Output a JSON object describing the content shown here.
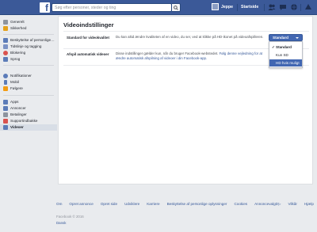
{
  "topbar": {
    "search_placeholder": "Søg efter personer, steder og ting",
    "user_name": "Jeppe",
    "home_label": "Startside",
    "brand_color": "#3b5998"
  },
  "sidebar": {
    "items": [
      {
        "label": "Generelt",
        "icon": "gear-icon",
        "color": "#8d949e"
      },
      {
        "label": "Sikkerhed",
        "icon": "shield-icon",
        "color": "#e4a11b"
      },
      {
        "label": "Beskyttelse af personlige…",
        "icon": "lock-icon",
        "color": "#5b7bb8"
      },
      {
        "label": "Tidslinje og tagging",
        "icon": "timeline-icon",
        "color": "#7b92c4"
      },
      {
        "label": "Blokering",
        "icon": "block-icon",
        "color": "#d9534f"
      },
      {
        "label": "Sprog",
        "icon": "language-icon",
        "color": "#5b7bb8"
      },
      {
        "label": "Notifikationer",
        "icon": "globe-icon",
        "color": "#5b7bb8"
      },
      {
        "label": "Mobil",
        "icon": "mobile-icon",
        "color": "#5b7bb8"
      },
      {
        "label": "Følgere",
        "icon": "rss-icon",
        "color": "#f39c12"
      },
      {
        "label": "Apps",
        "icon": "apps-icon",
        "color": "#5b7bb8"
      },
      {
        "label": "Annoncer",
        "icon": "ads-icon",
        "color": "#5b7bb8"
      },
      {
        "label": "Betalinger",
        "icon": "payment-icon",
        "color": "#8d949e"
      },
      {
        "label": "Supportindbakke",
        "icon": "support-icon",
        "color": "#d9534f"
      },
      {
        "label": "Videoer",
        "icon": "video-icon",
        "color": "#5b7bb8"
      }
    ]
  },
  "main": {
    "title": "Videoindstillinger",
    "rows": [
      {
        "label": "Standard for videokvalitet",
        "description": "Du kan altid ændre kvaliteten af en video, du ser, ved at klikke på HD-ikonet på videoafspilleren."
      },
      {
        "label": "Afspil automatisk videoer",
        "description_before": "Disse indstillinger gælder kun, når du bruger Facebook-webstedet. ",
        "description_link": "Følg denne vejledning for at ændre automatisk afspilning af videoer i din Facebook-app.",
        "description_after": ""
      }
    ],
    "dropdown": {
      "selected": "Standard",
      "options": [
        "Standard",
        "Kun SD",
        "HD hvis muligt"
      ],
      "highlighted": "HD hvis muligt",
      "button_color": "#4267b2"
    }
  },
  "footer": {
    "links": [
      "Om",
      "Opret annonce",
      "Opret side",
      "Udviklere",
      "Karriere",
      "Beskyttelse af personlige oplysninger",
      "Cookies",
      "AnnoncevalgD▷",
      "Vilkår",
      "Hjælp"
    ],
    "copyright": "Facebook © 2016",
    "language": "Dansk"
  }
}
